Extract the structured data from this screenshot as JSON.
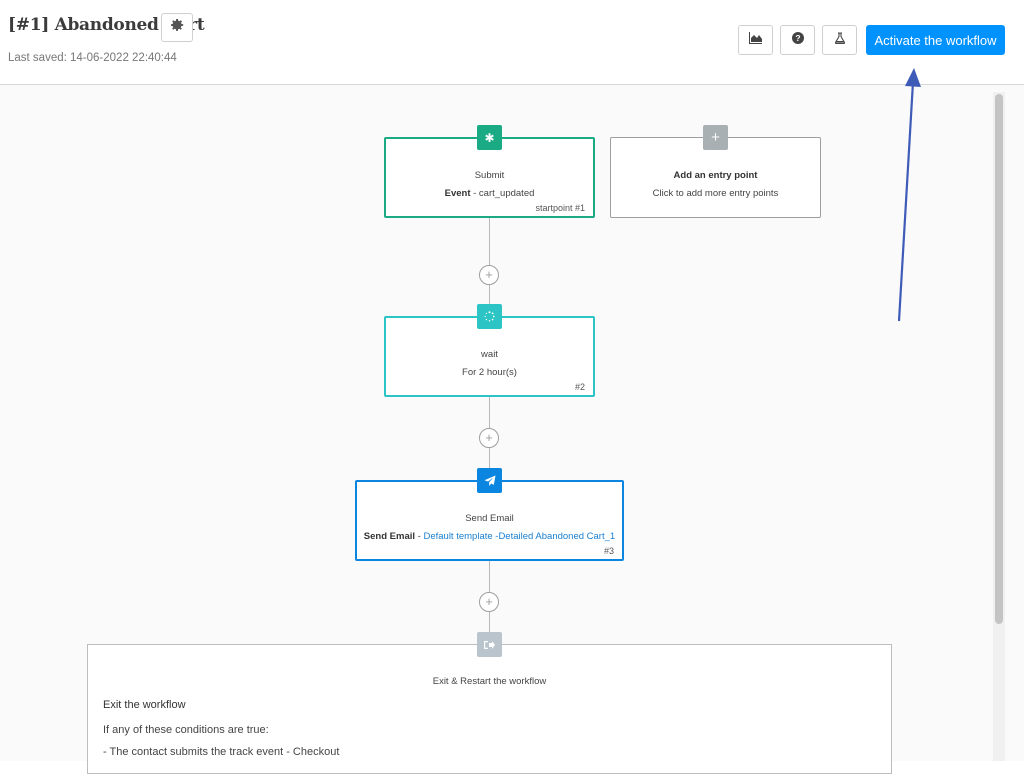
{
  "header": {
    "title": "[#1] Abandoned Cart",
    "saved": "Last saved: 14-06-2022 22:40:44",
    "activate_label": "Activate the workflow"
  },
  "toolbar": {
    "icons": [
      "area-chart-icon",
      "help-circle-icon",
      "flask-icon"
    ]
  },
  "colors": {
    "accent": "#0092ff",
    "event_green": "#1aaa84",
    "wait_teal": "#2cc4c4",
    "email_blue": "#0a85e0",
    "muted_grey": "#a8b0b4"
  },
  "workflow": {
    "nodes": [
      {
        "title": "Submit",
        "sub_bold": "Event",
        "sub_rest": " - cart_updated",
        "tag": "startpoint #1"
      },
      {
        "title": "Add an entry point",
        "sub": "Click to add more entry points"
      },
      {
        "title": "wait",
        "sub": "For 2 hour(s)",
        "tag": "#2"
      },
      {
        "title": "Send Email",
        "sub_bold": "Send Email",
        "sub_sep": " - ",
        "sub_link": "Default template -Detailed Abandoned Cart_1",
        "tag": "#3"
      }
    ],
    "exit": {
      "title": "Exit & Restart the workflow",
      "heading": "Exit the workflow",
      "condition_intro": "If any of these conditions are true:",
      "conditions": [
        "- The contact submits the track event - Checkout"
      ]
    }
  }
}
